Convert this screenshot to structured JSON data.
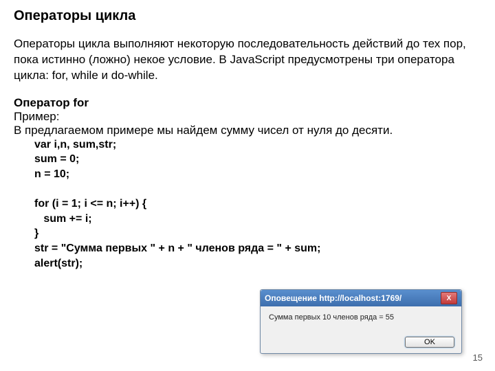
{
  "title": "Операторы цикла",
  "intro": "Операторы цикла выполняют некоторую последовательность действий до тех пор, пока истинно (ложно) некое условие. В JavaScript предусмотрены три оператора цикла: for, while и do-while.",
  "section_heading": "Оператор for",
  "example_label": "Пример:",
  "example_desc": "В предлагаемом примере мы найдем сумму чисел от нуля до десяти.",
  "code": "var i,n, sum,str;\nsum = 0;\nn = 10;\n\nfor (i = 1; i <= n; i++) {\n   sum += i;\n}\nstr = \"Сумма первых \" + n + \" членов ряда = \" + sum;\nalert(str);",
  "alert": {
    "title": "Оповещение http://localhost:1769/",
    "message": "Сумма первых 10 членов ряда = 55",
    "ok": "OK",
    "close": "X"
  },
  "page_number": "15"
}
